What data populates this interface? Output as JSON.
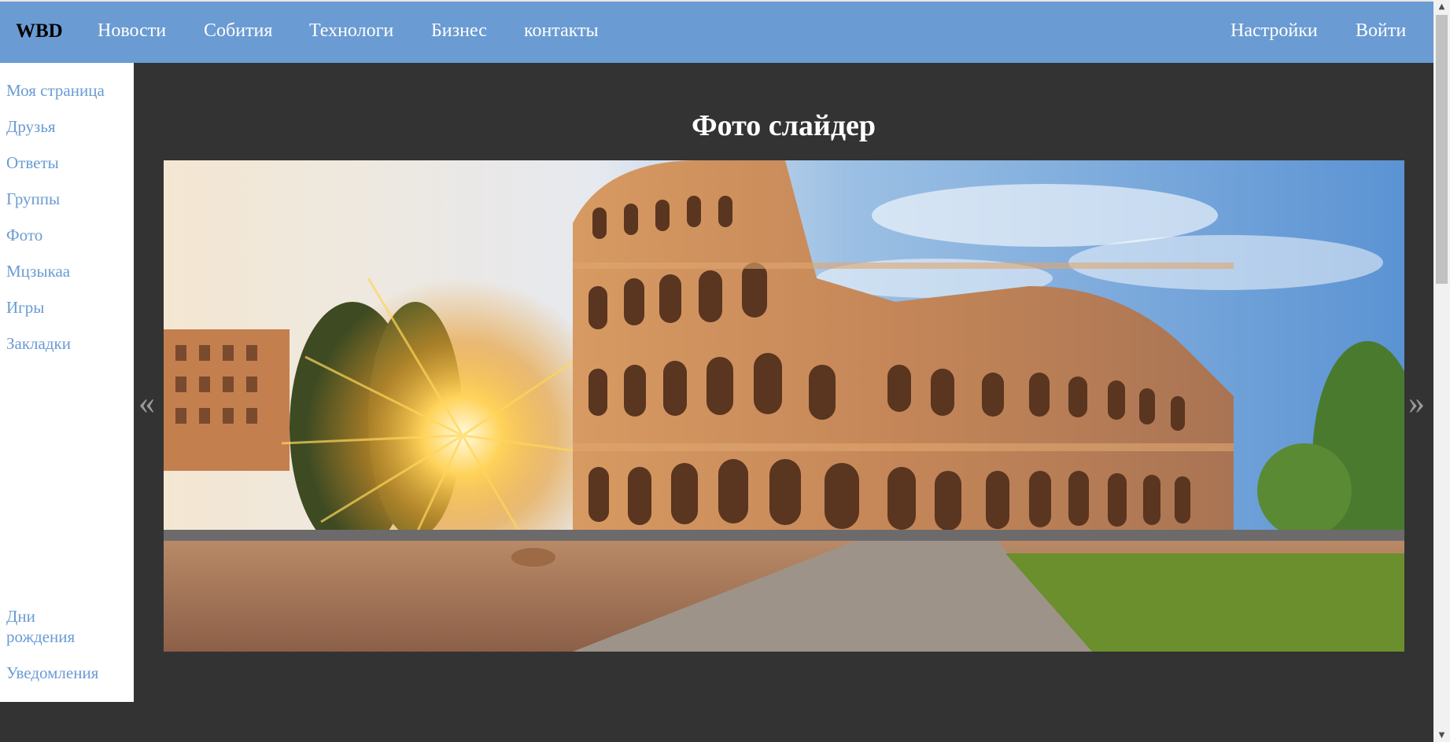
{
  "header": {
    "brand": "WBD",
    "nav": [
      "Новости",
      "Собития",
      "Технологи",
      "Бизнес",
      "контакты"
    ],
    "settings": "Настройки",
    "login": "Войти"
  },
  "sidebar": {
    "items": [
      "Моя страница",
      "Друзья",
      "Ответы",
      "Группы",
      "Фото",
      "Мцзыкаа",
      "Игры",
      "Закладки"
    ],
    "birthdays": "Дни рождения",
    "notifications": "Уведомления"
  },
  "main": {
    "title": "Фото слайдер",
    "prev": "«",
    "next": "»"
  },
  "colors": {
    "header_bg": "#6a9bd3",
    "page_bg": "#333333",
    "sidebar_link": "#6a9bd3"
  }
}
